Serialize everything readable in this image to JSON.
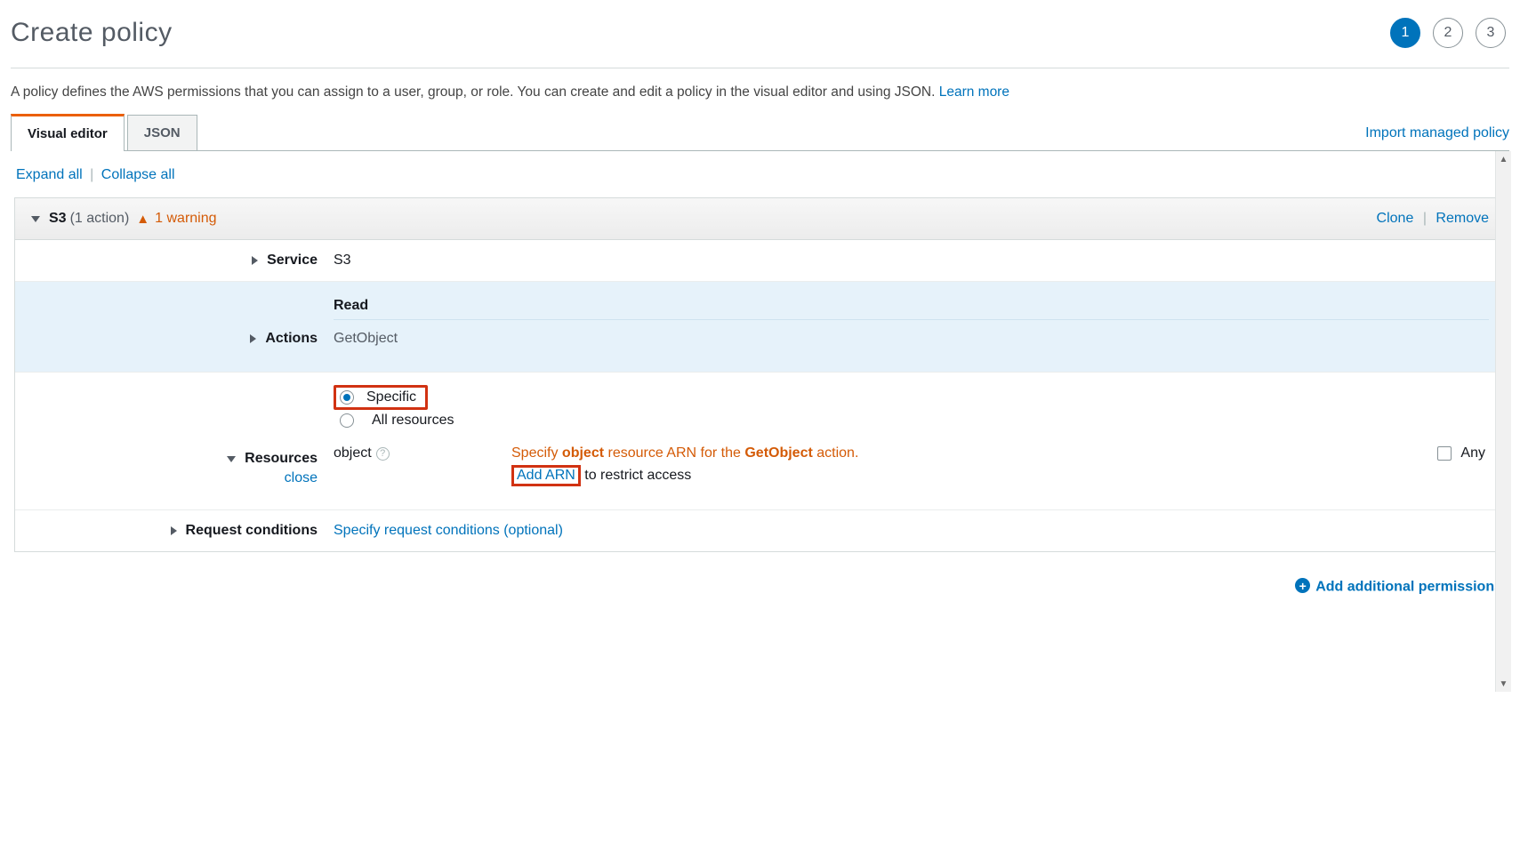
{
  "header": {
    "title": "Create policy",
    "steps": [
      "1",
      "2",
      "3"
    ],
    "activeStep": 0
  },
  "intro": {
    "text": "A policy defines the AWS permissions that you can assign to a user, group, or role. You can create and edit a policy in the visual editor and using JSON. ",
    "learnMore": "Learn more"
  },
  "tabs": {
    "visual": "Visual editor",
    "json": "JSON",
    "importLink": "Import managed policy"
  },
  "toolbar": {
    "expand": "Expand all",
    "collapse": "Collapse all"
  },
  "service": {
    "name": "S3",
    "count": "(1 action)",
    "warning": "1 warning",
    "clone": "Clone",
    "remove": "Remove"
  },
  "rows": {
    "serviceLabel": "Service",
    "serviceValue": "S3",
    "actionsLabel": "Actions",
    "actionsGroup": "Read",
    "actionsName": "GetObject",
    "resourcesLabel": "Resources",
    "resourcesClose": "close",
    "radioSpecific": "Specific",
    "radioAll": "All resources",
    "objectLabel": "object",
    "specifyPrefix": "Specify ",
    "specifyObject": "object",
    "specifyMid": " resource ARN for the ",
    "specifyAction": "GetObject",
    "specifySuffix": " action.",
    "addArn": "Add ARN",
    "restrict": " to restrict access",
    "any": "Any",
    "conditionsLabel": "Request conditions",
    "conditionsLink": "Specify request conditions (optional)"
  },
  "footer": {
    "addPerm": "Add additional permissions"
  }
}
